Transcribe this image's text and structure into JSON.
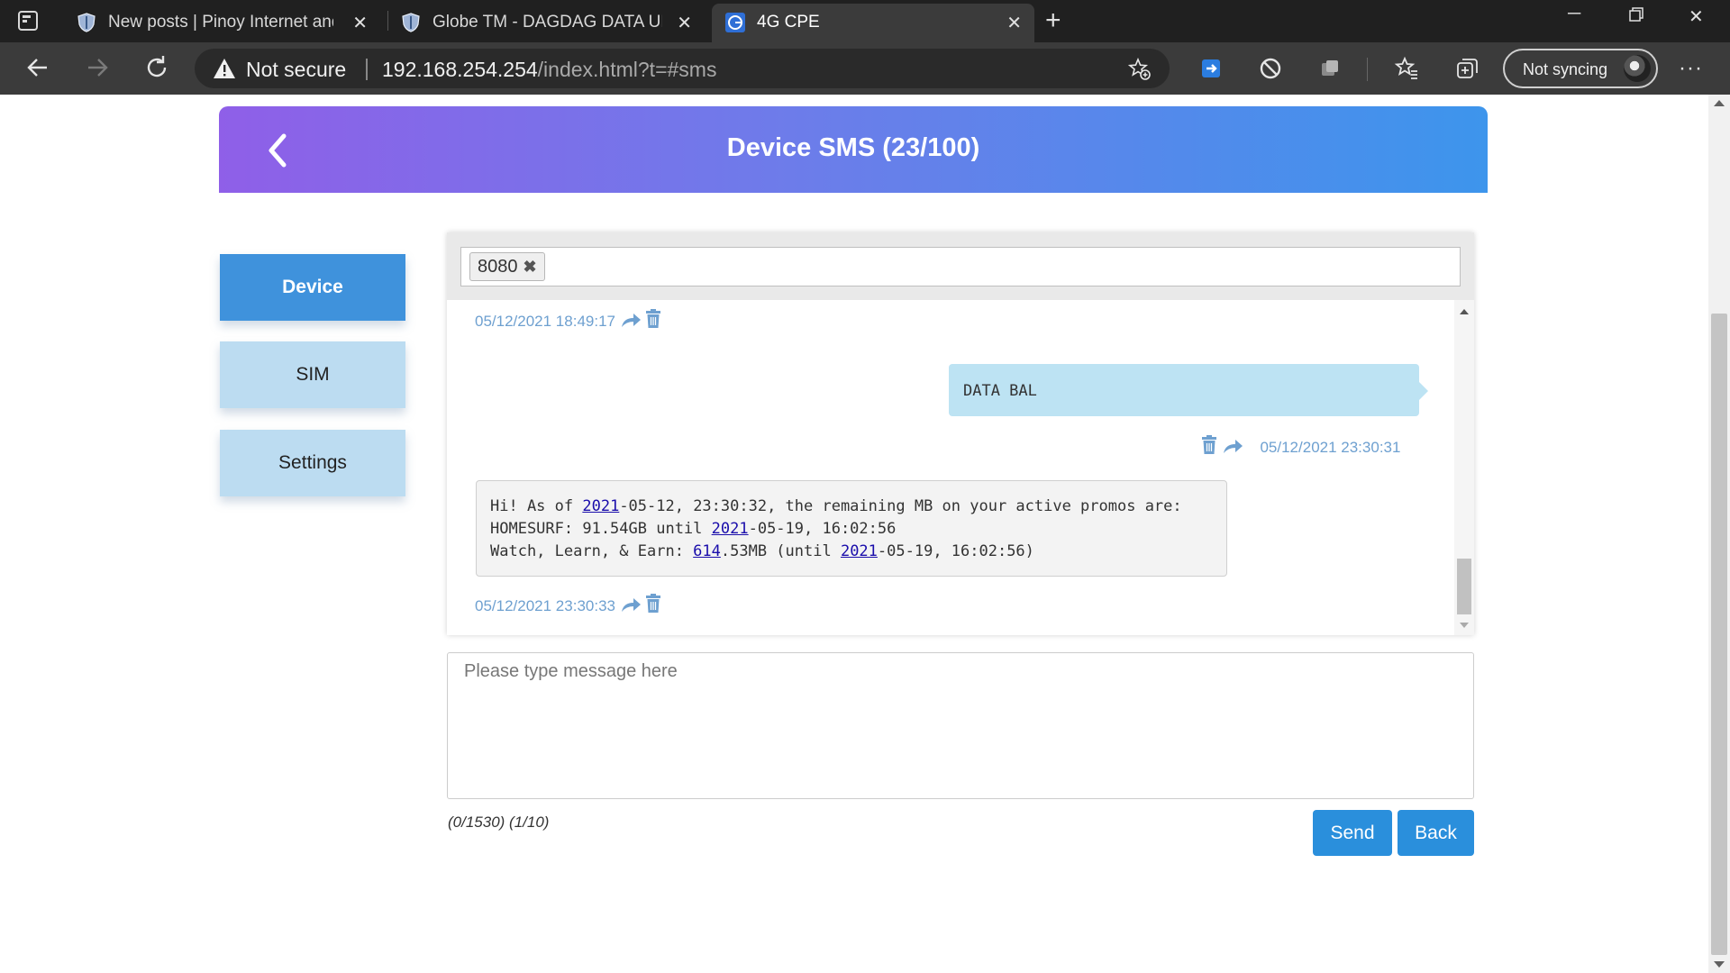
{
  "browser": {
    "tabs": [
      {
        "title": "New posts | Pinoy Internet and Te",
        "active": false
      },
      {
        "title": "Globe TM - DAGDAG DATA ULET",
        "active": false
      },
      {
        "title": "4G CPE",
        "active": true
      }
    ],
    "security_label": "Not secure",
    "url_host": "192.168.254.254",
    "url_path": "/index.html?t=#sms",
    "profile_label": "Not syncing"
  },
  "header": {
    "title": "Device SMS (23/100)"
  },
  "sidebar": {
    "items": [
      {
        "label": "Device",
        "active": true
      },
      {
        "label": "SIM",
        "active": false
      },
      {
        "label": "Settings",
        "active": false
      }
    ]
  },
  "recipient": {
    "number": "8080"
  },
  "messages": [
    {
      "direction": "in",
      "timestamp": "05/12/2021 18:49:17"
    },
    {
      "direction": "out",
      "text": "DATA BAL",
      "timestamp": "05/12/2021 23:30:31"
    },
    {
      "direction": "in",
      "line1_a": "Hi! As of ",
      "line1_link": "2021",
      "line1_b": "-05-12, 23:30:32, the remaining MB on your active promos are:",
      "line2_a": "HOMESURF: 91.54GB until ",
      "line2_link": "2021",
      "line2_b": "-05-19, 16:02:56",
      "line3_a": "Watch, Learn, & Earn: ",
      "line3_link1": "614",
      "line3_b": ".53MB (until ",
      "line3_link2": "2021",
      "line3_c": "-05-19, 16:02:56)",
      "timestamp": "05/12/2021 23:30:33"
    }
  ],
  "compose": {
    "placeholder": "Please type message here",
    "counter": "(0/1530) (1/10)"
  },
  "actions": {
    "send_label": "Send",
    "back_label": "Back"
  },
  "colors": {
    "accent": "#2a8fdc",
    "sidebar_active": "#3f92dc",
    "sidebar_inactive": "#bcdcf1",
    "timestamp": "#6ea0d0"
  }
}
